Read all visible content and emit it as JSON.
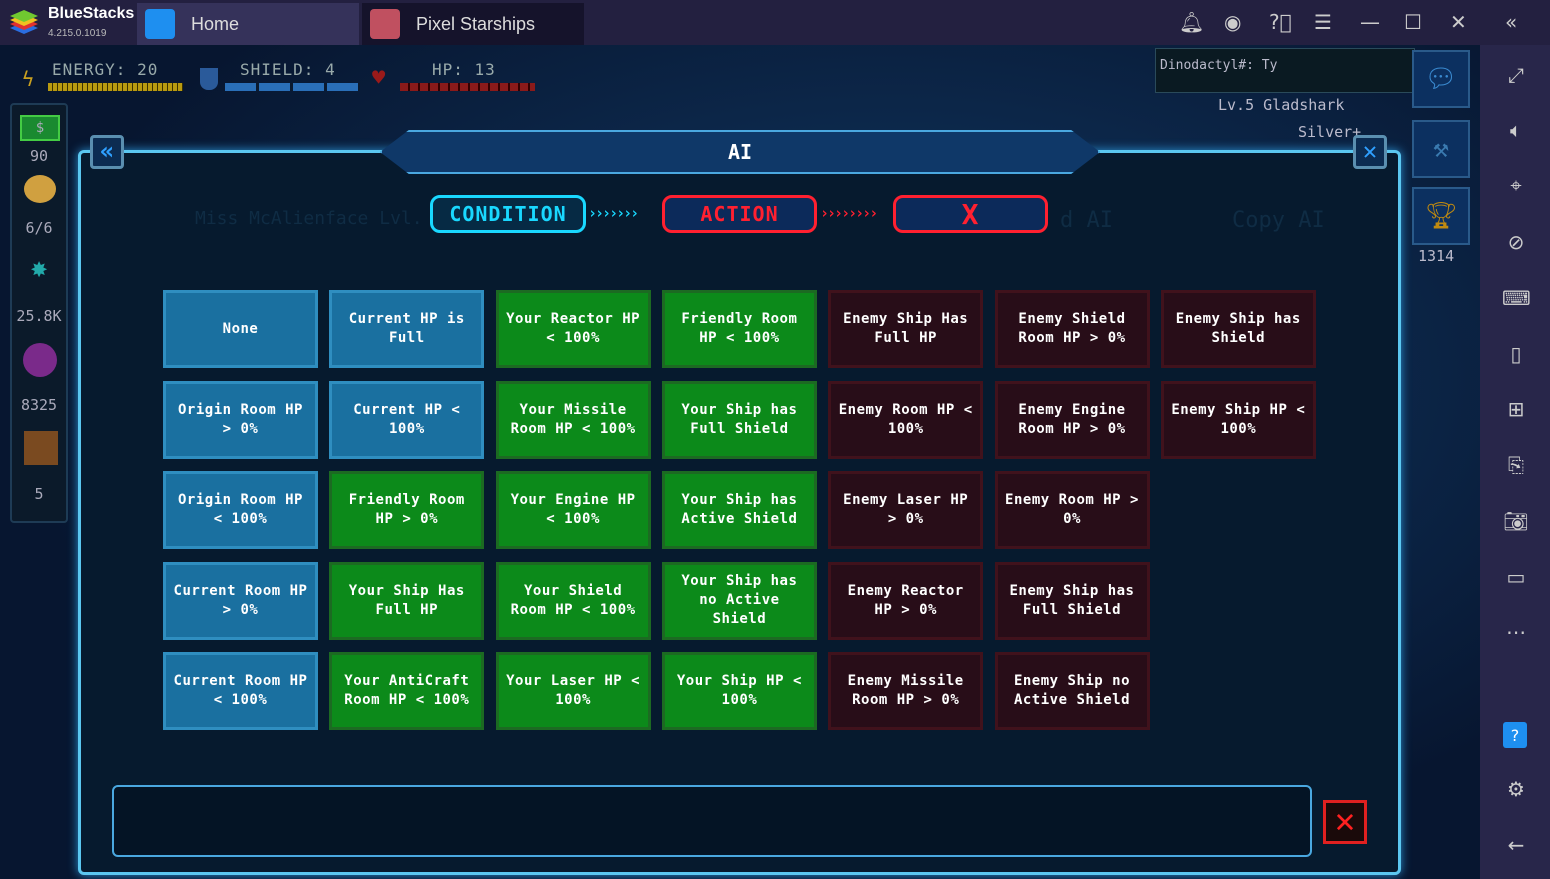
{
  "app": {
    "name": "BlueStacks",
    "version": "4.215.0.1019"
  },
  "tabs": [
    {
      "label": "Home"
    },
    {
      "label": "Pixel Starships"
    }
  ],
  "hud": {
    "energy": "ENERGY: 20",
    "shield": "SHIELD: 4",
    "hp": "HP: 13"
  },
  "left_panel": {
    "v1": "90",
    "v2": "6/6",
    "v3": "25.8K",
    "v4": "8325",
    "v5": "5"
  },
  "top_right": {
    "player": "Dinodactyl#: Ty",
    "ship": "Lv.5 Gladshark",
    "league": "Silver+",
    "trophies": "1314"
  },
  "background_text": {
    "room": "Miss McAlienface Lvl. 9 Room",
    "ai": "d AI",
    "copy": "Copy AI"
  },
  "dialog": {
    "title": "AI",
    "steps": {
      "condition": "CONDITION",
      "action": "ACTION",
      "third": "X"
    }
  },
  "conditions": [
    [
      {
        "label": "None",
        "color": "blue"
      },
      {
        "label": "Current HP is Full",
        "color": "blue"
      },
      {
        "label": "Your Reactor HP < 100%",
        "color": "green"
      },
      {
        "label": "Friendly Room HP < 100%",
        "color": "green"
      },
      {
        "label": "Enemy Ship Has Full HP",
        "color": "red"
      },
      {
        "label": "Enemy Shield Room HP > 0%",
        "color": "red"
      },
      {
        "label": "Enemy Ship has Shield",
        "color": "red"
      }
    ],
    [
      {
        "label": "Origin Room HP > 0%",
        "color": "blue"
      },
      {
        "label": "Current HP < 100%",
        "color": "blue"
      },
      {
        "label": "Your Missile Room HP < 100%",
        "color": "green"
      },
      {
        "label": "Your Ship has Full Shield",
        "color": "green"
      },
      {
        "label": "Enemy Room HP < 100%",
        "color": "red"
      },
      {
        "label": "Enemy Engine Room HP > 0%",
        "color": "red"
      },
      {
        "label": "Enemy Ship HP < 100%",
        "color": "red"
      }
    ],
    [
      {
        "label": "Origin Room HP < 100%",
        "color": "blue"
      },
      {
        "label": "Friendly Room HP > 0%",
        "color": "green"
      },
      {
        "label": "Your Engine HP < 100%",
        "color": "green"
      },
      {
        "label": "Your Ship has Active Shield",
        "color": "green"
      },
      {
        "label": "Enemy Laser HP > 0%",
        "color": "red"
      },
      {
        "label": "Enemy Room HP > 0%",
        "color": "red"
      }
    ],
    [
      {
        "label": "Current Room HP > 0%",
        "color": "blue"
      },
      {
        "label": "Your Ship Has Full HP",
        "color": "green"
      },
      {
        "label": "Your Shield Room HP < 100%",
        "color": "green"
      },
      {
        "label": "Your Ship has no Active Shield",
        "color": "green"
      },
      {
        "label": "Enemy Reactor HP > 0%",
        "color": "red"
      },
      {
        "label": "Enemy Ship has Full Shield",
        "color": "red"
      }
    ],
    [
      {
        "label": "Current Room HP < 100%",
        "color": "blue"
      },
      {
        "label": "Your AntiCraft Room HP < 100%",
        "color": "green"
      },
      {
        "label": "Your Laser HP < 100%",
        "color": "green"
      },
      {
        "label": "Your Ship HP < 100%",
        "color": "green"
      },
      {
        "label": "Enemy Missile Room HP > 0%",
        "color": "red"
      },
      {
        "label": "Enemy Ship no Active Shield",
        "color": "red"
      }
    ]
  ],
  "colors": {
    "condition": "#19d8ff",
    "action": "#ff2030",
    "blue": "#1a70a0",
    "green": "#0c8a1a",
    "red": "#280d18"
  }
}
